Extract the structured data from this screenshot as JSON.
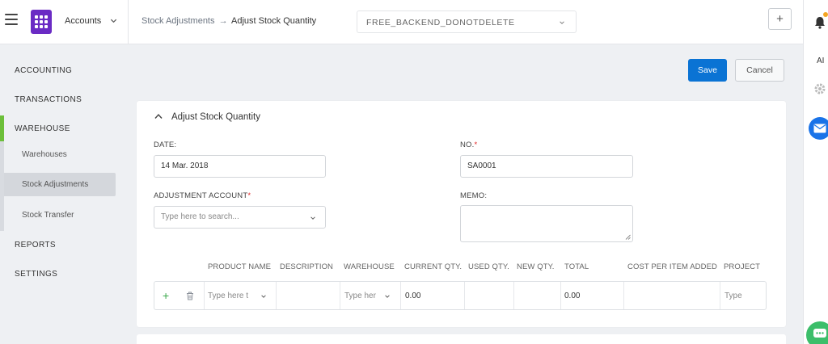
{
  "header": {
    "app_name": "Accounts",
    "breadcrumb_parent": "Stock Adjustments",
    "breadcrumb_sep": "→",
    "breadcrumb_current": "Adjust Stock Quantity",
    "company": "FREE_BACKEND_DONOTDELETE",
    "add_button": "+"
  },
  "right_rail": {
    "ai_label": "AI"
  },
  "sidebar": {
    "items": [
      {
        "label": "ACCOUNTING"
      },
      {
        "label": "TRANSACTIONS"
      },
      {
        "label": "WAREHOUSE"
      },
      {
        "label": "REPORTS"
      },
      {
        "label": "SETTINGS"
      }
    ],
    "warehouse_sub": [
      {
        "label": "Warehouses"
      },
      {
        "label": "Stock Adjustments"
      },
      {
        "label": "Stock Transfer"
      }
    ]
  },
  "actions": {
    "save": "Save",
    "cancel": "Cancel"
  },
  "form": {
    "section_title": "Adjust Stock Quantity",
    "date_label": "DATE:",
    "date_value": "14 Mar. 2018",
    "no_label": "NO.",
    "no_value": "SA0001",
    "account_label": "ADJUSTMENT ACCOUNT",
    "account_placeholder": "Type here to search...",
    "memo_label": "MEMO:",
    "required_mark": "*"
  },
  "table": {
    "columns": [
      "PRODUCT NAME",
      "DESCRIPTION",
      "WAREHOUSE",
      "CURRENT QTY.",
      "USED QTY.",
      "NEW QTY.",
      "TOTAL",
      "COST PER ITEM ADDED",
      "PROJECT"
    ],
    "row": {
      "product_placeholder": "Type here t",
      "warehouse_placeholder": "Type her",
      "current_qty": "0.00",
      "total": "0.00",
      "project_placeholder": "Type"
    }
  },
  "colors": {
    "accent": "#0a73d4",
    "active_nav": "#6cbf3a",
    "logo": "#6a2bc4"
  }
}
